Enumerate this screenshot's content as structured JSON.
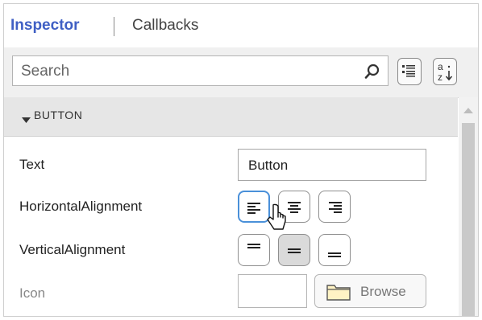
{
  "tabs": {
    "active": "Inspector",
    "inactive": "Callbacks"
  },
  "toolbar": {
    "search_placeholder": "Search",
    "categorize_button_icon": "list-view-icon",
    "sort_button_icon": "sort-alpha-icon"
  },
  "section": {
    "title": "BUTTON",
    "expanded": true
  },
  "properties": {
    "text": {
      "label": "Text",
      "value": "Button"
    },
    "horizontal_alignment": {
      "label": "HorizontalAlignment",
      "options": [
        "left",
        "center",
        "right"
      ],
      "selected": "left"
    },
    "vertical_alignment": {
      "label": "VerticalAlignment",
      "options": [
        "top",
        "center",
        "bottom"
      ],
      "selected": "center"
    },
    "icon": {
      "label": "Icon",
      "value": "",
      "browse_label": "Browse"
    }
  },
  "colors": {
    "accent": "#3f5fc4",
    "focus": "#4a90d9"
  }
}
